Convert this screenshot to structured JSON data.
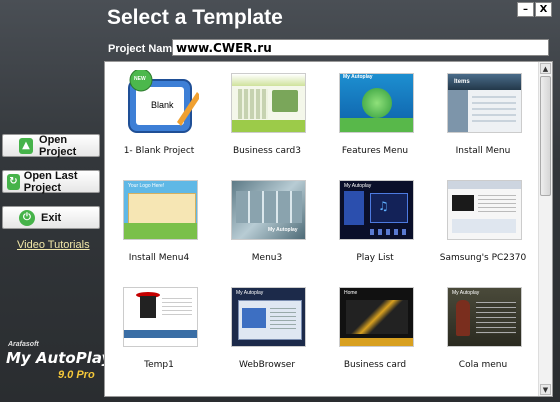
{
  "window": {
    "title": "Select a Template",
    "minimize_label": "–",
    "close_label": "X"
  },
  "project": {
    "label": "Project Name:",
    "value": "www.CWER.ru"
  },
  "sidebar": {
    "open_project": "Open Project",
    "open_last_project": "Open Last Project",
    "exit": "Exit",
    "video_tutorials": "Video Tutorials"
  },
  "logo": {
    "company": "Arafasoft",
    "product": "My AutoPlay",
    "version": "9.0 Pro"
  },
  "templates": [
    {
      "label": "1- Blank Project",
      "thumb_text": "Blank",
      "badge": "NEW"
    },
    {
      "label": "Business card3",
      "thumb_text": ""
    },
    {
      "label": "Features Menu",
      "thumb_text": "My Autoplay"
    },
    {
      "label": "Install Menu",
      "thumb_text": "Items"
    },
    {
      "label": "Install Menu4",
      "thumb_text": "Your Logo Here!"
    },
    {
      "label": "Menu3",
      "thumb_text": "My Autoplay"
    },
    {
      "label": "Play List",
      "thumb_text": "My Autoplay"
    },
    {
      "label": "Samsung's PC2370",
      "thumb_text": ""
    },
    {
      "label": "Temp1",
      "thumb_text": ""
    },
    {
      "label": "WebBrowser",
      "thumb_text": "My Autoplay"
    },
    {
      "label": "Business card",
      "thumb_text": "Home"
    },
    {
      "label": "Cola menu",
      "thumb_text": "My Autoplay"
    }
  ],
  "scrollbar": {
    "up": "▲",
    "down": "▼"
  }
}
